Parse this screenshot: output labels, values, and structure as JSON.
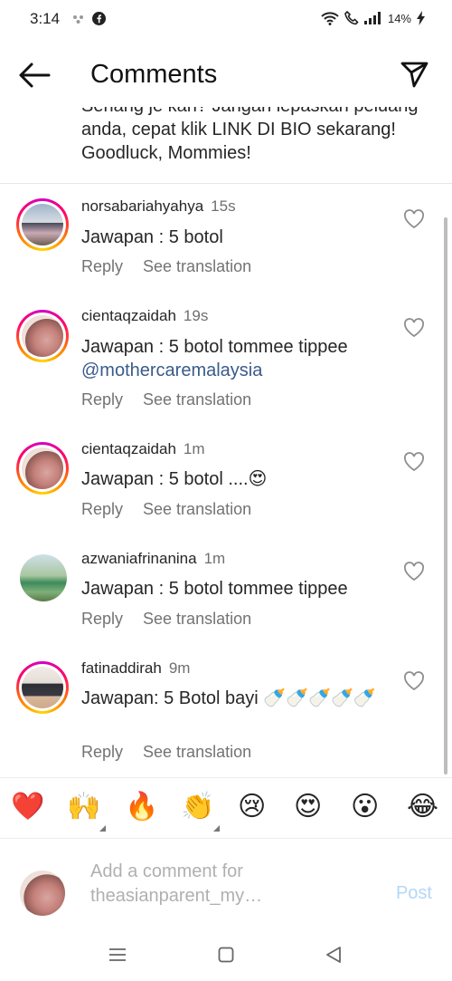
{
  "status": {
    "time": "3:14",
    "battery": "14%"
  },
  "header": {
    "title": "Comments"
  },
  "caption": {
    "text": "Senang je kan? Jangan lepaskan peluang anda, cepat klik LINK DI BIO sekarang! Goodluck, Mommies!"
  },
  "comments": [
    {
      "username": "norsabariahyahya",
      "time": "15s",
      "text": "Jawapan : 5 botol",
      "reply": "Reply",
      "translate": "See translation"
    },
    {
      "username": "cientaqzaidah",
      "time": "19s",
      "text": "Jawapan :  5 botol tommee tippee",
      "mention": "@mothercaremalaysia",
      "reply": "Reply",
      "translate": "See translation"
    },
    {
      "username": "cientaqzaidah",
      "time": "1m",
      "text": "Jawapan : 5 botol ....😍",
      "reply": "Reply",
      "translate": "See translation"
    },
    {
      "username": "azwaniafrinanina",
      "time": "1m",
      "text": "Jawapan : 5 botol tommee tippee",
      "reply": "Reply",
      "translate": "See translation"
    },
    {
      "username": "fatinaddirah",
      "time": "9m",
      "text": "Jawapan: 5 Botol bayi 🍼🍼🍼🍼🍼",
      "reply": "Reply",
      "translate": "See translation"
    }
  ],
  "reactions": [
    "❤️",
    "🙌",
    "🔥",
    "👏",
    "😢",
    "😍",
    "😮",
    "😂"
  ],
  "add_comment": {
    "placeholder": "Add a comment for theasianparent_my…",
    "post_label": "Post"
  },
  "icons": {
    "back": "arrow-left-icon",
    "send": "paper-plane-icon",
    "like": "heart-outline-icon"
  },
  "colors": {
    "mention": "#3a5a8c",
    "post": "#b3d7f7",
    "secondary_text": "#737373"
  }
}
